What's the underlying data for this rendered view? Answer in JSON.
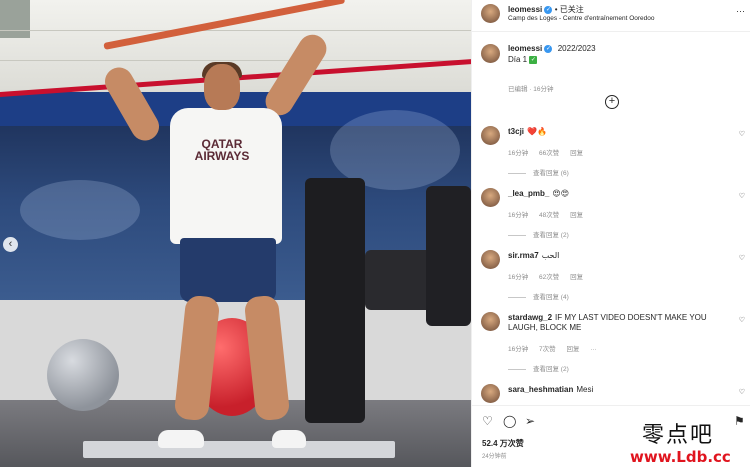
{
  "post_header": {
    "username": "leomessi",
    "follow_status": "已关注",
    "location": "Camp des Loges - Centre d'entraînement Ooredoo",
    "more_label": "···"
  },
  "photo": {
    "shirt_text": "QATAR AIRWAYS",
    "prev_arrow": "‹"
  },
  "caption": {
    "username": "leomessi",
    "date": "2022/2023",
    "body": "Día 1",
    "meta": "已编辑 · 16分钟",
    "load_more_icon": "+"
  },
  "comments": [
    {
      "username": "t3cji",
      "text": "❤️🔥",
      "age": "16分钟",
      "likes": "66次赞",
      "reply": "回复",
      "view_replies": "查看回复 (6)"
    },
    {
      "username": "_lea_pmb_",
      "text": "😍😍",
      "age": "16分钟",
      "likes": "48次赞",
      "reply": "回复",
      "view_replies": "查看回复 (2)"
    },
    {
      "username": "sir.rma7",
      "text": "الحب",
      "age": "16分钟",
      "likes": "62次赞",
      "reply": "回复",
      "view_replies": "查看回复 (4)"
    },
    {
      "username": "stardawg_2",
      "text": "IF MY LAST VIDEO DOESN'T MAKE YOU LAUGH, BLOCK ME",
      "age": "16分钟",
      "likes": "7次赞",
      "reply": "回复",
      "more": "···",
      "view_replies": "查看回复 (2)"
    },
    {
      "username": "sara_heshmatian",
      "text": "Mesi"
    }
  ],
  "actions": {
    "like_icon": "♡",
    "comment_icon": "◯",
    "share_icon": "➢",
    "save_icon": "⚑",
    "likes": "52.4 万次赞",
    "time": "24分钟前"
  },
  "watermark": {
    "cn": "零点吧",
    "url": "www.Ldb.cc"
  },
  "colors": {
    "verified": "#3897f0",
    "meta_gray": "#8e8e8e",
    "text": "#262626",
    "watermark_red": "#e0141e"
  }
}
